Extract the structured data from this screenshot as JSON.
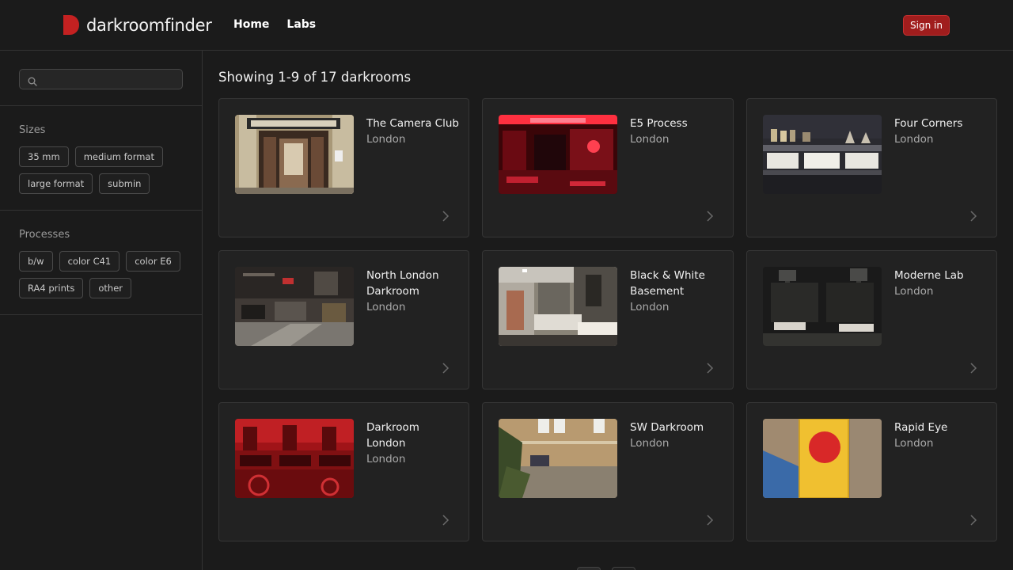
{
  "brand": {
    "name": "darkroomfinder",
    "accent": "#c42121"
  },
  "nav": {
    "home": "Home",
    "labs": "Labs"
  },
  "header": {
    "signin": "Sign in"
  },
  "search": {
    "placeholder": "",
    "value": ""
  },
  "filters": {
    "sizes_title": "Sizes",
    "sizes": [
      "35 mm",
      "medium format",
      "large format",
      "submin"
    ],
    "processes_title": "Processes",
    "processes": [
      "b/w",
      "color C41",
      "color E6",
      "RA4 prints",
      "other"
    ]
  },
  "results": {
    "title": "Showing 1-9 of 17 darkrooms"
  },
  "cards": [
    {
      "name": "The Camera Club",
      "city": "London",
      "thumb": "camera-club"
    },
    {
      "name": "E5 Process",
      "city": "London",
      "thumb": "red-room"
    },
    {
      "name": "Four Corners",
      "city": "London",
      "thumb": "trays"
    },
    {
      "name": "North London Darkroom",
      "city": "London",
      "thumb": "workshop"
    },
    {
      "name": "Black & White Basement",
      "city": "London",
      "thumb": "basement"
    },
    {
      "name": "Moderne Lab",
      "city": "London",
      "thumb": "dark-lab"
    },
    {
      "name": "Darkroom London",
      "city": "London",
      "thumb": "red-enlargers"
    },
    {
      "name": "SW Darkroom",
      "city": "London",
      "thumb": "brick-building"
    },
    {
      "name": "Rapid Eye",
      "city": "London",
      "thumb": "sign"
    }
  ],
  "icons": {
    "search": "search-icon",
    "chevron": "chevron-right-icon",
    "logo": "logo-icon"
  }
}
